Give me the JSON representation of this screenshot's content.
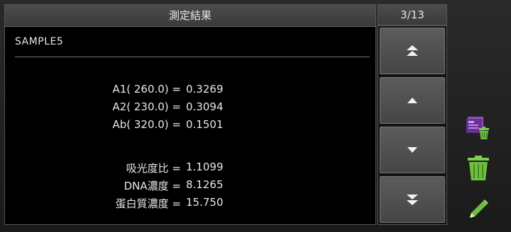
{
  "panel": {
    "title": "測定結果",
    "sample_name": "SAMPLE5"
  },
  "pager": {
    "counter": "3/13"
  },
  "results": [
    {
      "label": "A1( 260.0) =",
      "value": "0.3269"
    },
    {
      "label": "A2( 230.0) =",
      "value": "0.3094"
    },
    {
      "label": "Ab( 320.0) =",
      "value": "0.1501"
    },
    {
      "label": "吸光度比 =",
      "value": "1.1099"
    },
    {
      "label": "DNA濃度 =",
      "value": "8.1265"
    },
    {
      "label": "蛋白質濃度 =",
      "value": "15.750"
    }
  ],
  "nav": {
    "buttons": [
      "scroll-to-top-icon",
      "scroll-up-icon",
      "scroll-down-icon",
      "scroll-to-bottom-icon"
    ]
  },
  "toolbar": {
    "icons": [
      "delete-all-icon",
      "trash-icon",
      "edit-pencil-icon"
    ],
    "accent_green": "#6fbf3f",
    "accent_purple": "#7a3fa0"
  }
}
